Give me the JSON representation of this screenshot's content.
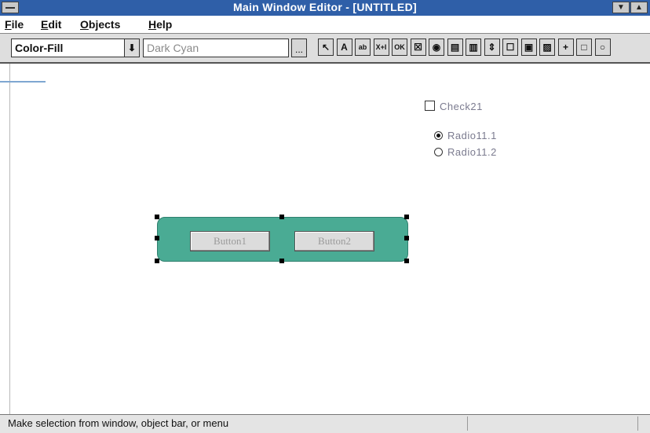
{
  "window": {
    "title": "Main Window Editor - [UNTITLED]"
  },
  "menu": [
    {
      "label": "File",
      "mnemonic": "F"
    },
    {
      "label": "Edit",
      "mnemonic": "E"
    },
    {
      "label": "Objects",
      "mnemonic": "O"
    },
    {
      "label": "Help",
      "mnemonic": "H"
    }
  ],
  "toolbar": {
    "property_select": "Color-Fill",
    "value_select": "Dark Cyan",
    "ellipsis": "...",
    "tools": [
      {
        "icon": "pointer-icon",
        "glyph": "↖"
      },
      {
        "icon": "text-label-icon",
        "glyph": "A"
      },
      {
        "icon": "text-field-icon",
        "glyph": "ab"
      },
      {
        "icon": "scroll-icon",
        "glyph": "X+I"
      },
      {
        "icon": "push-button-icon",
        "glyph": "OK"
      },
      {
        "icon": "checkbox-tool-icon",
        "glyph": "☒"
      },
      {
        "icon": "radio-tool-icon",
        "glyph": "◉"
      },
      {
        "icon": "listbox-icon",
        "glyph": "▤"
      },
      {
        "icon": "combobox-icon",
        "glyph": "▥"
      },
      {
        "icon": "spin-icon",
        "glyph": "⇕"
      },
      {
        "icon": "frame-icon",
        "glyph": "☐"
      },
      {
        "icon": "picture-icon",
        "glyph": "▣"
      },
      {
        "icon": "image-box-icon",
        "glyph": "▨"
      },
      {
        "icon": "line-icon",
        "glyph": "+"
      },
      {
        "icon": "rectangle-icon",
        "glyph": "□"
      },
      {
        "icon": "ellipse-icon",
        "glyph": "○"
      }
    ]
  },
  "canvas": {
    "checkbox": {
      "label": "Check21",
      "checked": false
    },
    "radios": [
      {
        "label": "Radio11.1",
        "selected": true
      },
      {
        "label": "Radio11.2",
        "selected": false
      }
    ],
    "group": {
      "fill_color": "#4aab94"
    },
    "buttons": [
      "Button1",
      "Button2"
    ]
  },
  "status": {
    "text": "Make selection from window, object bar, or menu"
  }
}
